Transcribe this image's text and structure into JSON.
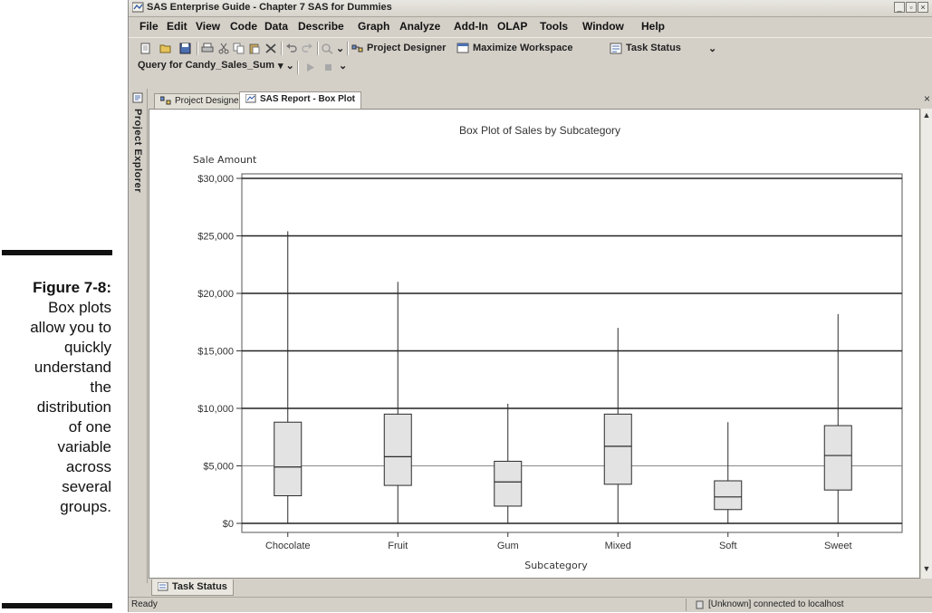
{
  "caption": {
    "label": "Figure 7-8:",
    "lines": [
      "Box plots",
      "allow you to",
      "quickly",
      "understand",
      "the",
      "distribution",
      "of one",
      "variable",
      "across",
      "several",
      "groups."
    ]
  },
  "window": {
    "title": "SAS Enterprise Guide - Chapter 7 SAS for Dummies",
    "controls": [
      "_",
      "▫",
      "×"
    ]
  },
  "menu": [
    "File",
    "Edit",
    "View",
    "Code",
    "Data",
    "Describe",
    "Graph",
    "Analyze",
    "Add-In",
    "OLAP",
    "Tools",
    "Window",
    "Help"
  ],
  "toolbar": {
    "project_designer": "Project Designer",
    "maximize_workspace": "Maximize Workspace",
    "task_status": "Task Status"
  },
  "query": {
    "name": "Query for Candy_Sales_Sum"
  },
  "sidebar": {
    "project_explorer": "Project Explorer"
  },
  "tabs": [
    {
      "label": "Project Designer",
      "active": false
    },
    {
      "label": "SAS Report - Box Plot",
      "active": true
    }
  ],
  "bottom_tab": "Task Status",
  "status": {
    "left": "Ready",
    "right": "[Unknown] connected to localhost"
  },
  "chart_data": {
    "type": "boxplot",
    "title": "Box Plot of Sales by Subcategory",
    "xlabel": "Subcategory",
    "ylabel": "Sale Amount",
    "ylim": [
      0,
      30000
    ],
    "yticks": [
      0,
      5000,
      10000,
      15000,
      20000,
      25000,
      30000
    ],
    "ytick_labels": [
      "$0",
      "$5,000",
      "$10,000",
      "$15,000",
      "$20,000",
      "$25,000",
      "$30,000"
    ],
    "categories": [
      "Chocolate",
      "Fruit",
      "Gum",
      "Mixed",
      "Soft",
      "Sweet"
    ],
    "boxes": [
      {
        "min": 0,
        "q1": 2400,
        "median": 4900,
        "q3": 8800,
        "max": 25400
      },
      {
        "min": 0,
        "q1": 3300,
        "median": 5800,
        "q3": 9500,
        "max": 21000
      },
      {
        "min": 0,
        "q1": 1500,
        "median": 3600,
        "q3": 5400,
        "max": 10400
      },
      {
        "min": 0,
        "q1": 3400,
        "median": 6700,
        "q3": 9500,
        "max": 17000
      },
      {
        "min": 0,
        "q1": 1200,
        "median": 2300,
        "q3": 3700,
        "max": 8800
      },
      {
        "min": 0,
        "q1": 2900,
        "median": 5900,
        "q3": 8500,
        "max": 18200
      }
    ],
    "grid": true,
    "colors": {
      "box_fill": "#e3e3e3",
      "line": "#2a2a2a",
      "grid": "#222222"
    }
  }
}
